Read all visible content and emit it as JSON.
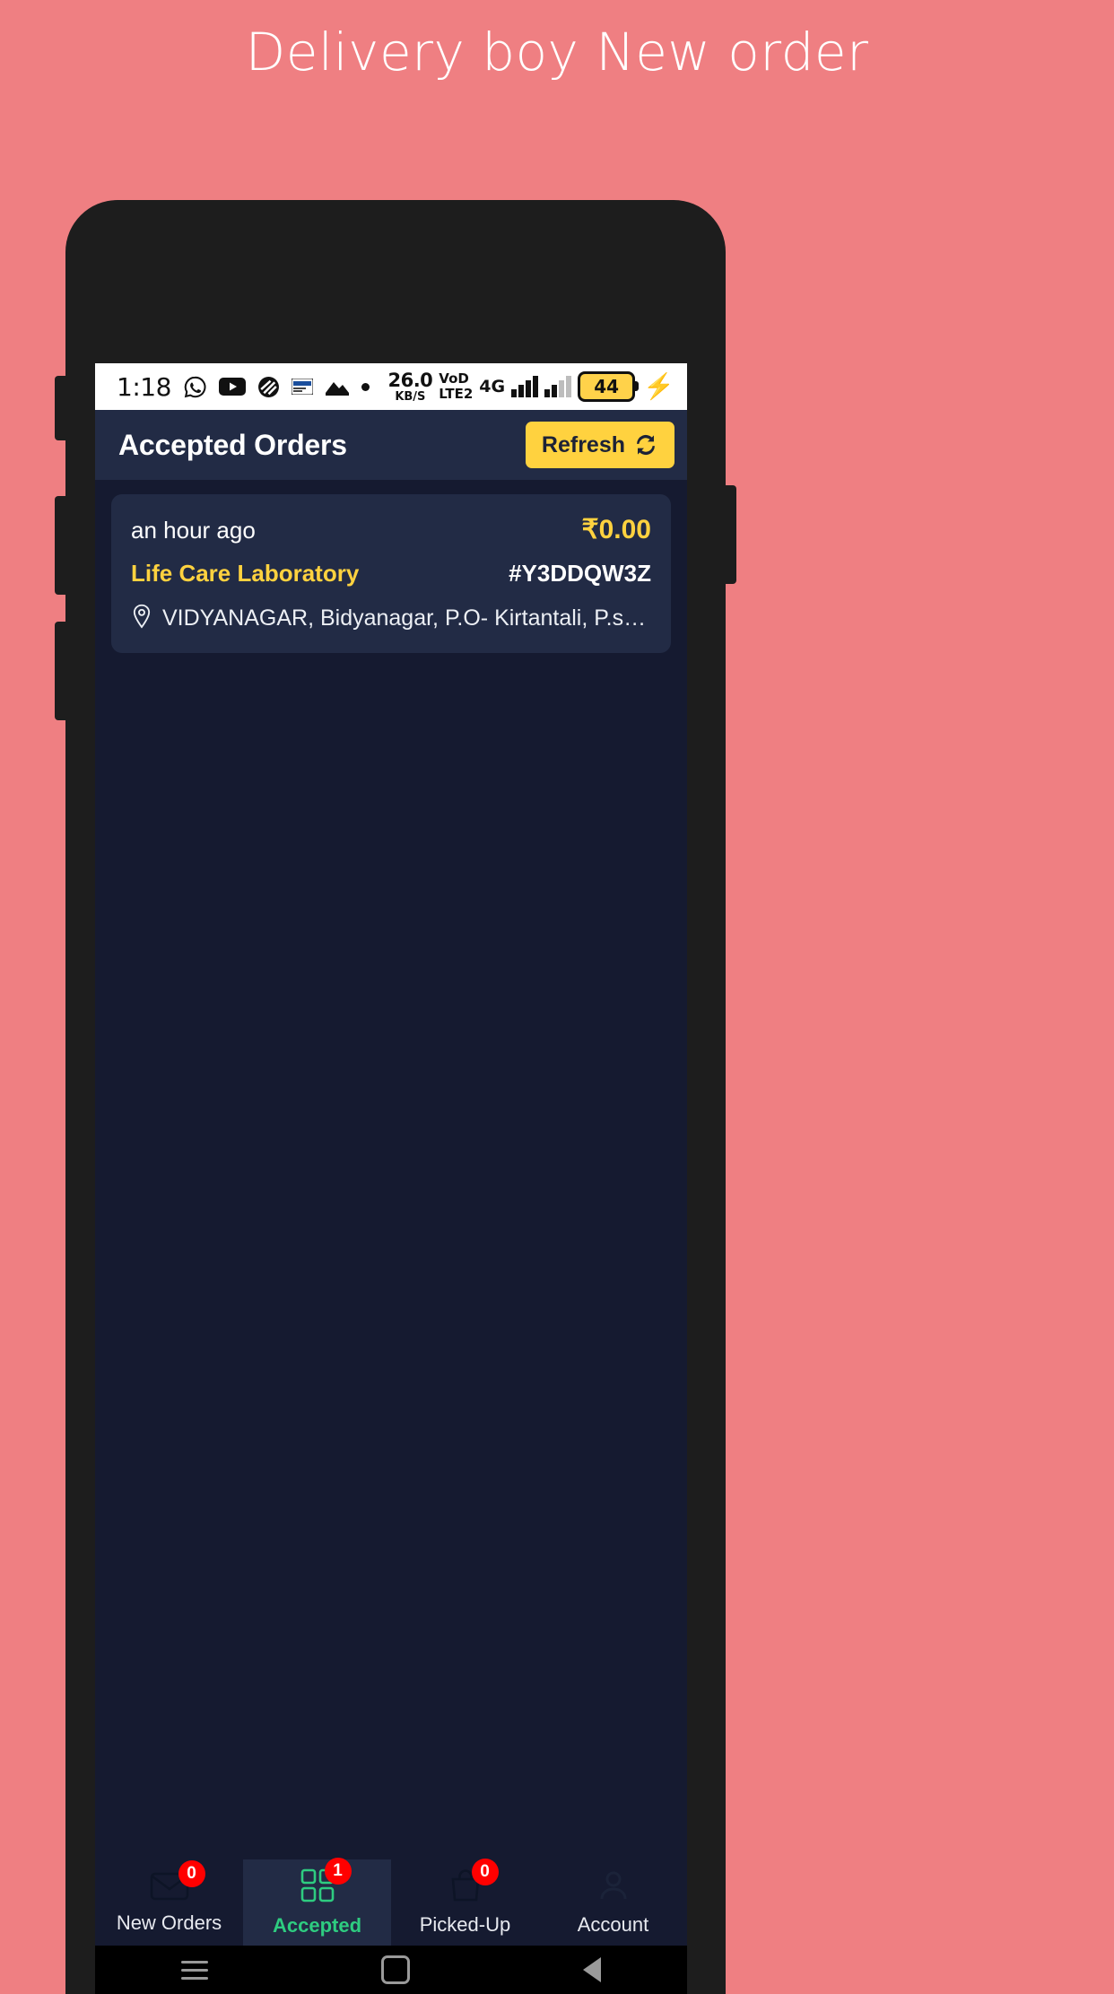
{
  "promo": {
    "title": "Delivery boy New order"
  },
  "colors": {
    "page_background": "#ef7f82",
    "app_surface": "#222b45",
    "app_background": "#151a30",
    "accent_yellow": "#ffd23f",
    "accent_green": "#2ecc80",
    "badge_red": "#ff0000",
    "status_bar_bg": "#ffffff"
  },
  "status_bar": {
    "time": "1:18",
    "app_icons": [
      "whatsapp-icon",
      "youtube-icon",
      "stripe-icon",
      "paytm-icon",
      "gallery-icon",
      "dot-icon"
    ],
    "network_speed_value": "26.0",
    "network_speed_unit": "KB/S",
    "volte_line1": "VoD",
    "volte_line2": "LTE2",
    "network_type": "4G",
    "battery_level": "44",
    "charging_icon": "lightning-bolt-icon"
  },
  "header": {
    "title": "Accepted Orders",
    "refresh_label": "Refresh",
    "refresh_icon": "refresh-icon"
  },
  "orders": [
    {
      "time_ago": "an hour ago",
      "price": "₹0.00",
      "lab_name": "Life Care Laboratory",
      "order_id": "#Y3DDQW3Z",
      "address_icon": "location-pin-icon",
      "address": "VIDYANAGAR, Bidyanagar, P.O- Kirtantali, P.s- K..."
    }
  ],
  "bottom_nav": {
    "items": [
      {
        "label": "New Orders",
        "icon": "envelope-icon",
        "badge": "0",
        "active": false
      },
      {
        "label": "Accepted",
        "icon": "grid-icon",
        "badge": "1",
        "active": true
      },
      {
        "label": "Picked-Up",
        "icon": "shopping-bag-icon",
        "badge": "0",
        "active": false
      },
      {
        "label": "Account",
        "icon": "person-icon",
        "badge": "",
        "active": false
      }
    ]
  },
  "system_nav": {
    "recents_icon": "hamburger-icon",
    "home_icon": "home-square-icon",
    "back_icon": "back-triangle-icon"
  }
}
